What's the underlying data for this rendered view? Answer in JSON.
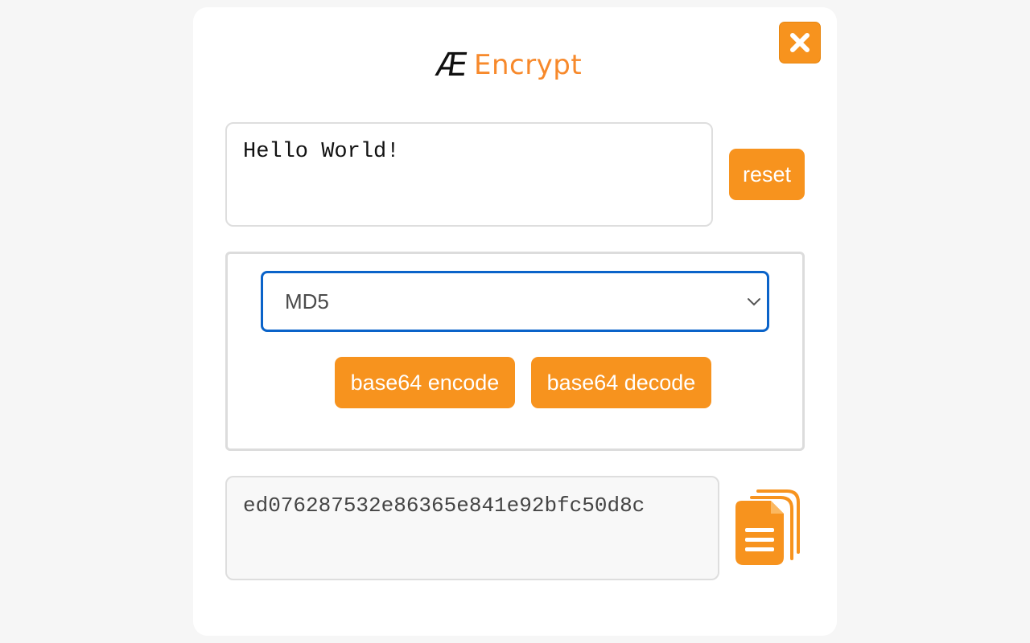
{
  "header": {
    "logo_mark": "Æ",
    "logo_text": "Encrypt"
  },
  "input": {
    "value": "Hello World!"
  },
  "actions": {
    "reset_label": "reset",
    "close_icon": "close-icon",
    "copy_icon": "copy-document-icon"
  },
  "algorithm": {
    "selected": "MD5"
  },
  "base64": {
    "encode_label": "base64 encode",
    "decode_label": "base64 decode"
  },
  "output": {
    "value": "ed076287532e86365e841e92bfc50d8c"
  },
  "colors": {
    "accent": "#f7931e",
    "logo_orange": "#f7892b",
    "select_border": "#0a63c9"
  }
}
